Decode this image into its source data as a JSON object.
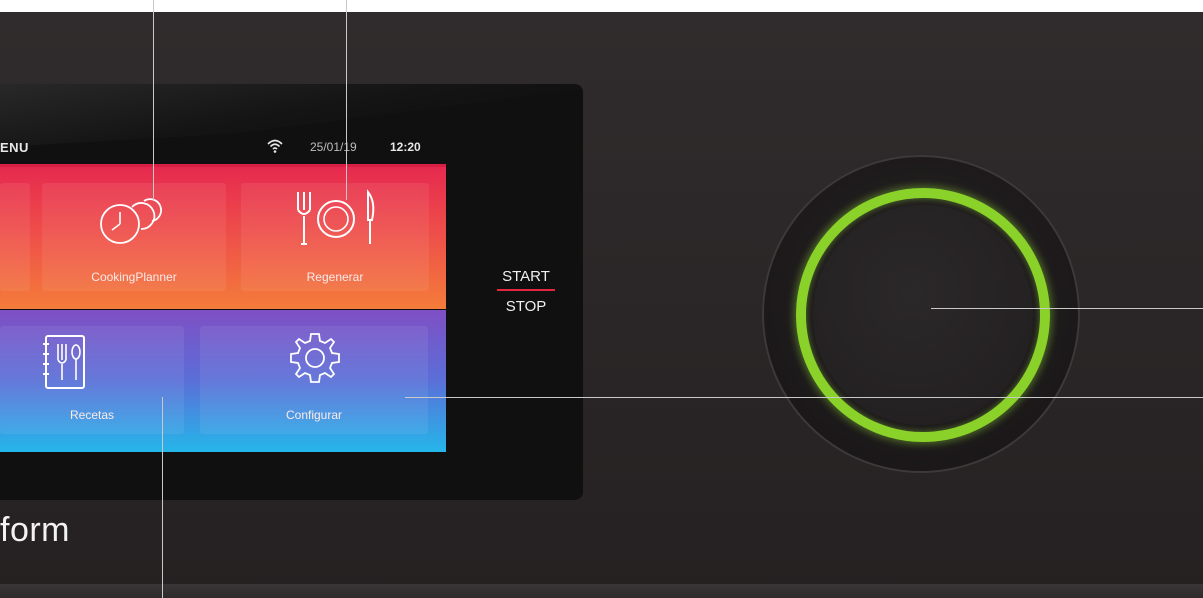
{
  "status_bar": {
    "menu_label": "ENU",
    "date": "25/01/19",
    "time": "12:20",
    "wifi_icon": "wifi-icon"
  },
  "tiles": {
    "cooking_planner": {
      "label": "CookingPlanner",
      "icon": "clocks-icon"
    },
    "regenerar": {
      "label": "Regenerar",
      "icon": "plate-cutlery-icon"
    },
    "recetas": {
      "label": "Recetas",
      "icon": "recipe-book-icon"
    },
    "configurar": {
      "label": "Configurar",
      "icon": "gear-icon"
    }
  },
  "controls": {
    "start_label": "START",
    "stop_label": "STOP",
    "knob_ring_color": "#8ad12a"
  },
  "brand": {
    "text": "form"
  },
  "colors": {
    "top_row_gradient": [
      "#e62a4e",
      "#f47c3a"
    ],
    "bottom_row_gradient": [
      "#7f4fc4",
      "#25b6ea"
    ],
    "panel": "#2b2728"
  }
}
